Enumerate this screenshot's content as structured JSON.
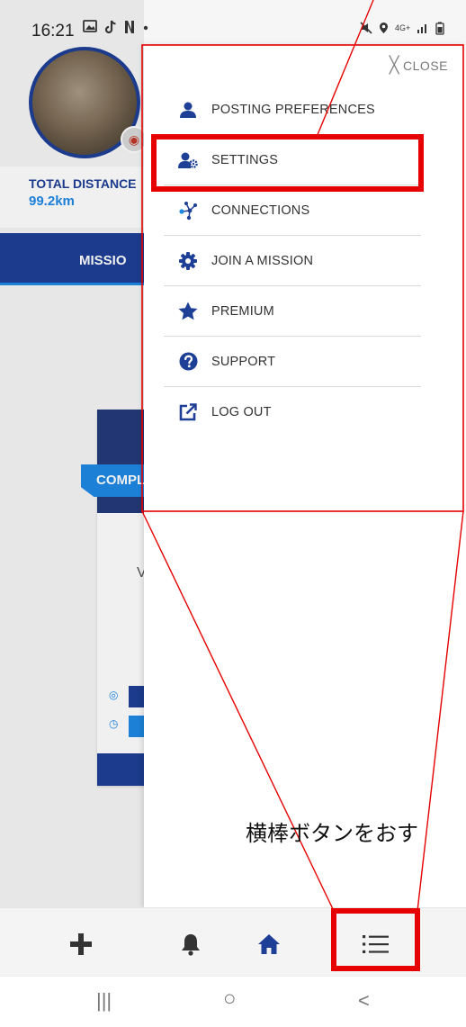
{
  "status_bar": {
    "time": "16:21",
    "left_icons": [
      "gallery-icon",
      "tiktok-icon",
      "netflix-icon",
      "dot-icon"
    ],
    "network": "4G+"
  },
  "profile": {
    "total_distance_label": "TOTAL DISTANCE",
    "total_distance_value": "99.2km"
  },
  "tabs": {
    "mission_label": "MISSIO"
  },
  "mission_card": {
    "ribbon_label": "COMPL",
    "partial_text": "V"
  },
  "drawer": {
    "close_label": "CLOSE",
    "items": [
      {
        "label": "POSTING PREFERENCES",
        "icon": "user-icon"
      },
      {
        "label": "SETTINGS",
        "icon": "user-gear-icon"
      },
      {
        "label": "CONNECTIONS",
        "icon": "connections-icon"
      },
      {
        "label": "JOIN A MISSION",
        "icon": "gear-icon"
      },
      {
        "label": "PREMIUM",
        "icon": "star-icon"
      },
      {
        "label": "SUPPORT",
        "icon": "question-icon"
      },
      {
        "label": "LOG OUT",
        "icon": "external-link-icon"
      }
    ]
  },
  "bottom_nav": {
    "items": [
      "plus-icon",
      "bell-icon",
      "home-icon",
      "menu-list-icon"
    ]
  },
  "system_nav": {
    "recent": "|||",
    "home": "○",
    "back": "<"
  },
  "annotation": {
    "text": "横棒ボタンをおす",
    "color": "#e60000"
  },
  "colors": {
    "brand_navy": "#1e3f96",
    "brand_blue": "#1e88e5",
    "highlight_red": "#e60000"
  }
}
